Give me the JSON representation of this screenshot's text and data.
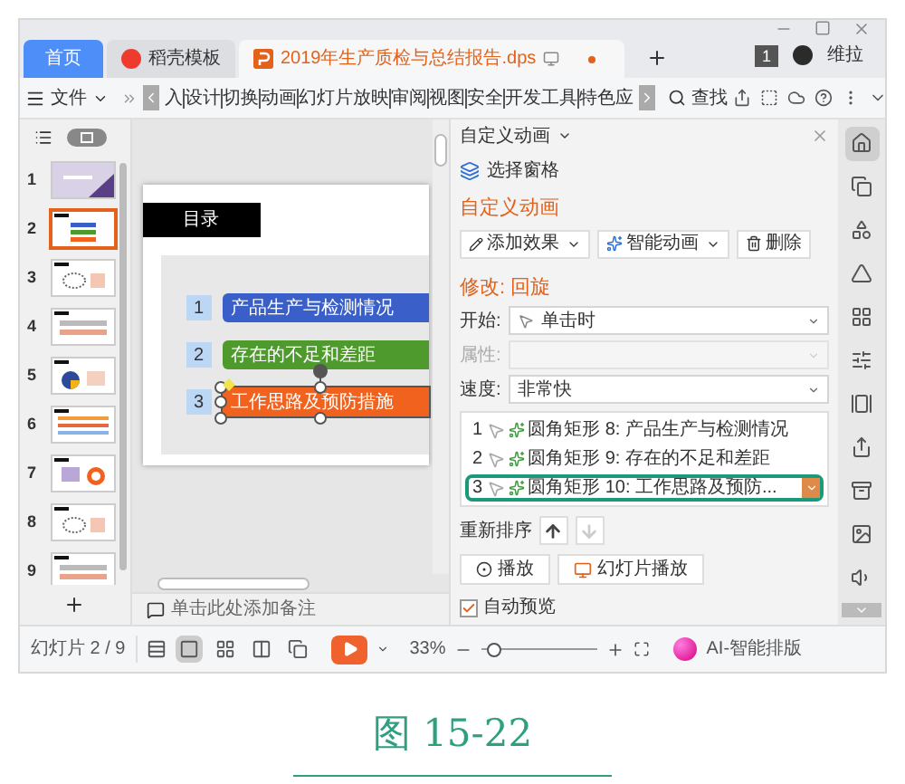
{
  "tabs": [
    {
      "label": "首页",
      "kind": "home",
      "selected": false
    },
    {
      "label": "稻壳模板",
      "kind": "store",
      "selected": false
    },
    {
      "label": "2019年生产质检与总结报告.dps",
      "kind": "document",
      "selected": true
    }
  ],
  "account": {
    "badge": "1",
    "name": "维拉"
  },
  "menu": {
    "file": "文件",
    "ribbon_tabs": [
      "入",
      "设计",
      "切换",
      "动画",
      "幻灯片放映",
      "审阅",
      "视图",
      "安全",
      "开发工具",
      "特色应"
    ],
    "search": "查找"
  },
  "slides": [
    {
      "number": "1",
      "selected": false
    },
    {
      "number": "2",
      "selected": true
    },
    {
      "number": "3",
      "selected": false
    },
    {
      "number": "4",
      "selected": false
    },
    {
      "number": "5",
      "selected": false
    },
    {
      "number": "6",
      "selected": false
    },
    {
      "number": "7",
      "selected": false
    },
    {
      "number": "8",
      "selected": false
    },
    {
      "number": "9",
      "selected": false
    }
  ],
  "slide": {
    "title": "目录",
    "items": [
      {
        "number": "1",
        "label": "产品生产与检测情况",
        "color": "#3a5fc8",
        "selected": false
      },
      {
        "number": "2",
        "label": "存在的不足和差距",
        "color": "#4f9a2c",
        "selected": false
      },
      {
        "number": "3",
        "label": "工作思路及预防措施",
        "color": "#f0621e",
        "selected": true
      }
    ]
  },
  "notes": {
    "placeholder": "单击此处添加备注"
  },
  "pane": {
    "title": "自定义动画",
    "selection_pane": "选择窗格",
    "section": "自定义动画",
    "buttons": [
      {
        "label": "添加效果",
        "kind": "add",
        "dropdown": true
      },
      {
        "label": "智能动画",
        "kind": "smart",
        "dropdown": true
      },
      {
        "label": "删除",
        "kind": "delete",
        "dropdown": false
      }
    ],
    "modify": "修改: 回旋",
    "fields": [
      {
        "label": "开始:",
        "value": "单击时",
        "kind": "trigger",
        "disabled": false
      },
      {
        "label": "属性:",
        "kind": "plain",
        "disabled": true
      },
      {
        "label": "速度:",
        "value": "非常快",
        "kind": "plain",
        "disabled": false
      }
    ],
    "animations": [
      {
        "number": "1",
        "label": "圆角矩形 8: 产品生产与检测情况",
        "selected": false
      },
      {
        "number": "2",
        "label": "圆角矩形 9: 存在的不足和差距",
        "selected": false
      },
      {
        "number": "3",
        "label": "圆角矩形 10: 工作思路及预防...",
        "selected": true
      }
    ],
    "reorder": {
      "label": "重新排序",
      "up_disabled": false,
      "down_disabled": true
    },
    "play_buttons": [
      {
        "label": "播放",
        "kind": "play"
      },
      {
        "label": "幻灯片播放",
        "kind": "slideshow"
      }
    ],
    "autopreview": {
      "label": "自动预览",
      "checked": true
    }
  },
  "side_tools": [
    {
      "selected": true
    },
    {
      "selected": false
    },
    {
      "selected": false
    },
    {
      "selected": false
    },
    {
      "selected": false
    },
    {
      "selected": false
    },
    {
      "selected": false
    },
    {
      "selected": false
    },
    {
      "selected": false
    },
    {
      "selected": false
    },
    {
      "selected": false
    }
  ],
  "status": {
    "slide_info": "幻灯片 2 / 9",
    "views": [
      {
        "selected": true
      },
      {
        "selected": false
      },
      {
        "selected": false
      },
      {
        "selected": false
      }
    ],
    "zoom": "33%",
    "zoom_slider": {
      "level": 0.1
    },
    "ai": "AI-智能排版"
  },
  "caption": "图 15-22"
}
